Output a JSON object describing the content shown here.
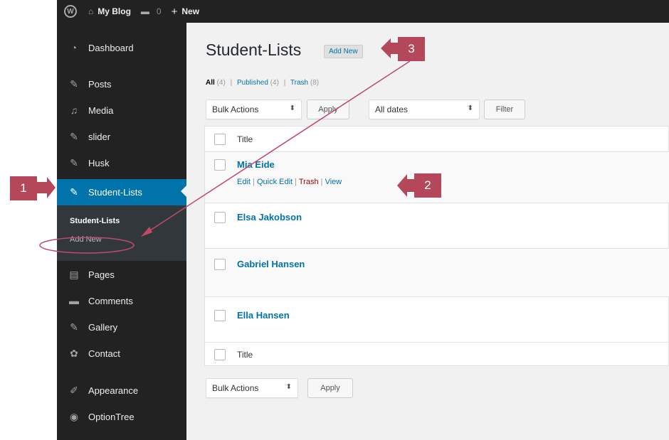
{
  "adminbar": {
    "site_name": "My Blog",
    "comments_count": "0",
    "new_label": "New"
  },
  "sidebar": {
    "items": [
      {
        "label": "Dashboard",
        "icon": "dashboard-icon",
        "glyph": "◔"
      },
      {
        "label": "Posts",
        "icon": "pushpin-icon",
        "glyph": "✎"
      },
      {
        "label": "Media",
        "icon": "media-icon",
        "glyph": "♫"
      },
      {
        "label": "slider",
        "icon": "pushpin-icon",
        "glyph": "✎"
      },
      {
        "label": "Husk",
        "icon": "pushpin-icon",
        "glyph": "✎"
      },
      {
        "label": "Student-Lists",
        "icon": "pushpin-icon",
        "glyph": "✎",
        "current": true
      },
      {
        "label": "Pages",
        "icon": "pages-icon",
        "glyph": "▤"
      },
      {
        "label": "Comments",
        "icon": "comment-icon",
        "glyph": "▬"
      },
      {
        "label": "Gallery",
        "icon": "pushpin-icon",
        "glyph": "✎"
      },
      {
        "label": "Contact",
        "icon": "gear-icon",
        "glyph": "✿"
      },
      {
        "label": "Appearance",
        "icon": "brush-icon",
        "glyph": "✐"
      },
      {
        "label": "OptionTree",
        "icon": "optiontree-icon",
        "glyph": "◉"
      }
    ],
    "submenu": {
      "current": "Student-Lists",
      "add_new": "Add New"
    }
  },
  "main": {
    "title": "Student-Lists",
    "add_new": "Add New",
    "filters": {
      "all": "All",
      "all_count": "(4)",
      "published": "Published",
      "published_count": "(4)",
      "trash": "Trash",
      "trash_count": "(8)",
      "sep": "|"
    },
    "bulk_actions": "Bulk Actions",
    "apply": "Apply",
    "all_dates": "All dates",
    "filter": "Filter",
    "column_title": "Title",
    "rows": [
      {
        "title": "Mia Eide",
        "actions": [
          "Edit",
          "Quick Edit",
          "Trash",
          "View"
        ]
      },
      {
        "title": "Elsa Jakobson"
      },
      {
        "title": "Gabriel Hansen"
      },
      {
        "title": "Ella Hansen"
      }
    ]
  },
  "annotations": {
    "callouts": [
      "1",
      "2",
      "3"
    ],
    "color": "#b5475b"
  }
}
